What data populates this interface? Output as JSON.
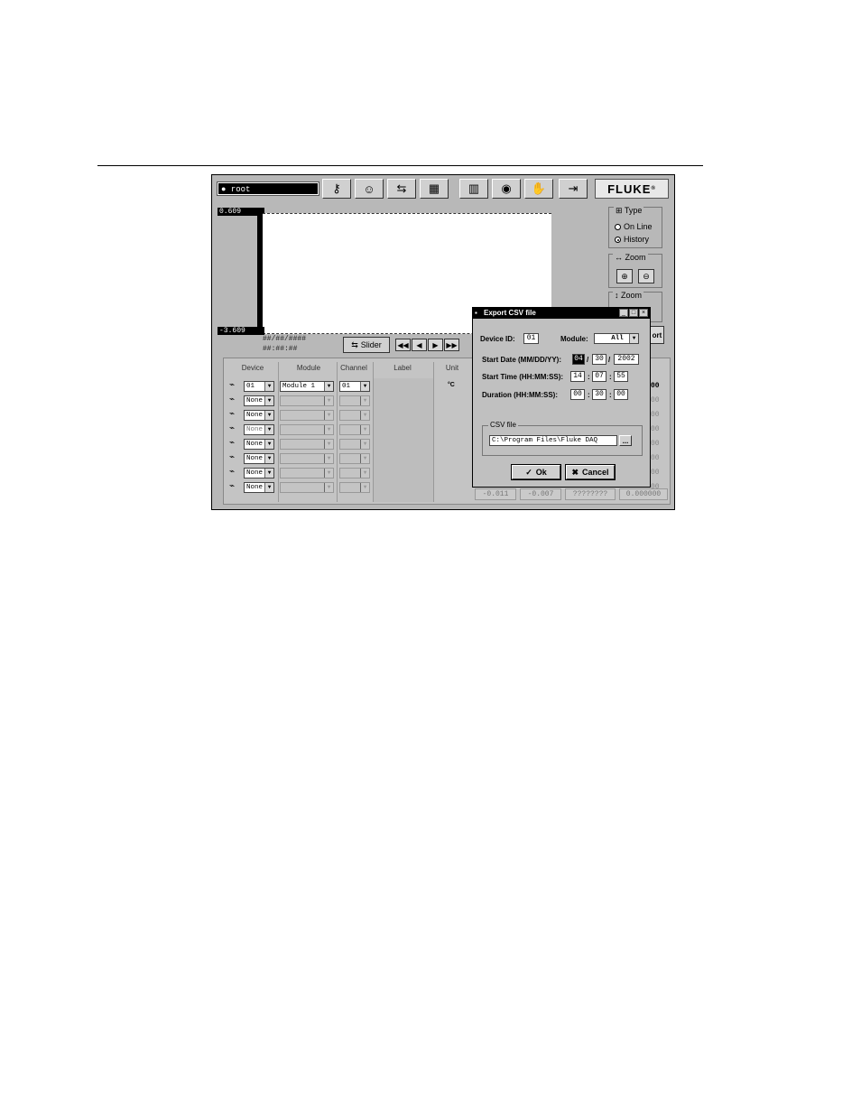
{
  "app": {
    "user": "root",
    "logo": "FLUKE",
    "toolbar_icons": [
      "key-icon",
      "person-icon",
      "sync-icon",
      "network-icon",
      "bar-chart-icon",
      "bulb-icon",
      "hand-icon",
      "exit-icon"
    ],
    "y_max_label": "0.609",
    "y_min_label": "-3.609",
    "hash_line_1": "##/##/####",
    "hash_line_2": "##:##:##",
    "slider_label": "Slider",
    "type_group": {
      "title": "Type",
      "online_label": "On Line",
      "history_label": "History",
      "selected": "History"
    },
    "zoom_h": {
      "title": "Zoom"
    },
    "zoom_v": {
      "title": "Zoom"
    },
    "export_fragment": "ort"
  },
  "grid": {
    "headers": [
      "Device",
      "Module",
      "Channel",
      "Label",
      "Unit"
    ],
    "rows": [
      {
        "device": "01",
        "module": "Module 1",
        "channel": "01",
        "unit": "°C",
        "value_fragment": "00"
      },
      {
        "device": "None",
        "module": "",
        "channel": "",
        "value_fragment": "00"
      },
      {
        "device": "None",
        "module": "",
        "channel": "",
        "value_fragment": "00"
      },
      {
        "device": "None",
        "module": "",
        "channel": "",
        "value_fragment": "00"
      },
      {
        "device": "None",
        "module": "",
        "channel": "",
        "value_fragment": "00"
      },
      {
        "device": "None",
        "module": "",
        "channel": "",
        "value_fragment": "00"
      },
      {
        "device": "None",
        "module": "",
        "channel": "",
        "value_fragment": "00"
      },
      {
        "device": "None",
        "module": "",
        "channel": "",
        "value_fragment": "00"
      }
    ],
    "bottom_values": [
      "-0.011",
      "-0.007",
      "????????",
      "0.000000"
    ]
  },
  "dialog": {
    "title": "Export CSV file",
    "device_id_label": "Device ID:",
    "device_id": "01",
    "module_label": "Module:",
    "module": "All",
    "start_date_label": "Start Date (MM/DD/YY):",
    "start_date": [
      "04",
      "30",
      "2002"
    ],
    "start_time_label": "Start Time (HH:MM:SS):",
    "start_time": [
      "14",
      "07",
      "55"
    ],
    "duration_label": "Duration (HH:MM:SS):",
    "duration": [
      "00",
      "30",
      "00"
    ],
    "csv_group_label": "CSV file",
    "csv_path": "C:\\Program Files\\Fluke DAQ",
    "browse_label": "...",
    "ok_label": "Ok",
    "cancel_label": "Cancel"
  }
}
